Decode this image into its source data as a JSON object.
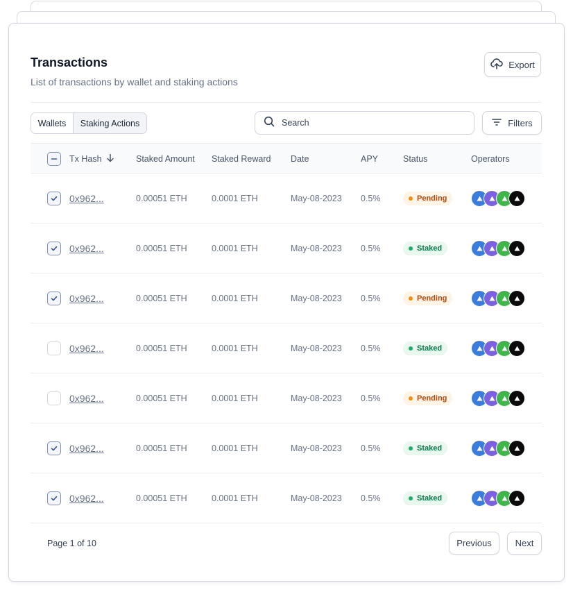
{
  "header": {
    "title": "Transactions",
    "subtitle": "List of transactions by wallet and staking actions",
    "export_label": "Export"
  },
  "toolbar": {
    "tabs": [
      "Wallets",
      "Staking Actions"
    ],
    "active_tab": "Staking Actions",
    "search_placeholder": "Search",
    "filters_label": "Filters"
  },
  "table": {
    "columns": [
      "Tx Hash",
      "Staked Amount",
      "Staked Reward",
      "Date",
      "APY",
      "Status",
      "Operators"
    ],
    "header_checkbox": "indeterminate",
    "rows": [
      {
        "checked": true,
        "hash": "0x962...",
        "amount": "0.00051 ETH",
        "reward": "0.0001 ETH",
        "date": "May-08-2023",
        "apy": "0.5%",
        "status": "Pending"
      },
      {
        "checked": true,
        "hash": "0x962...",
        "amount": "0.00051 ETH",
        "reward": "0.0001 ETH",
        "date": "May-08-2023",
        "apy": "0.5%",
        "status": "Staked"
      },
      {
        "checked": true,
        "hash": "0x962...",
        "amount": "0.00051 ETH",
        "reward": "0.0001 ETH",
        "date": "May-08-2023",
        "apy": "0.5%",
        "status": "Pending"
      },
      {
        "checked": false,
        "hash": "0x962...",
        "amount": "0.00051 ETH",
        "reward": "0.0001 ETH",
        "date": "May-08-2023",
        "apy": "0.5%",
        "status": "Staked"
      },
      {
        "checked": false,
        "hash": "0x962...",
        "amount": "0.00051 ETH",
        "reward": "0.0001 ETH",
        "date": "May-08-2023",
        "apy": "0.5%",
        "status": "Pending"
      },
      {
        "checked": true,
        "hash": "0x962...",
        "amount": "0.00051 ETH",
        "reward": "0.0001 ETH",
        "date": "May-08-2023",
        "apy": "0.5%",
        "status": "Staked"
      },
      {
        "checked": true,
        "hash": "0x962...",
        "amount": "0.00051 ETH",
        "reward": "0.0001 ETH",
        "date": "May-08-2023",
        "apy": "0.5%",
        "status": "Staked"
      }
    ]
  },
  "operators": {
    "colors": [
      "#3b7ddd",
      "#7b61e0",
      "#3fb54a",
      "#0b0b0b"
    ],
    "icon": "triangle-icon"
  },
  "status_colors": {
    "Pending": {
      "bg": "#fff4e5",
      "text": "#b54708",
      "dot": "#f79009"
    },
    "Staked": {
      "bg": "#e8f8ee",
      "text": "#067647",
      "dot": "#17b26a"
    }
  },
  "pagination": {
    "page_info": "Page 1 of 10",
    "previous_label": "Previous",
    "next_label": "Next"
  }
}
